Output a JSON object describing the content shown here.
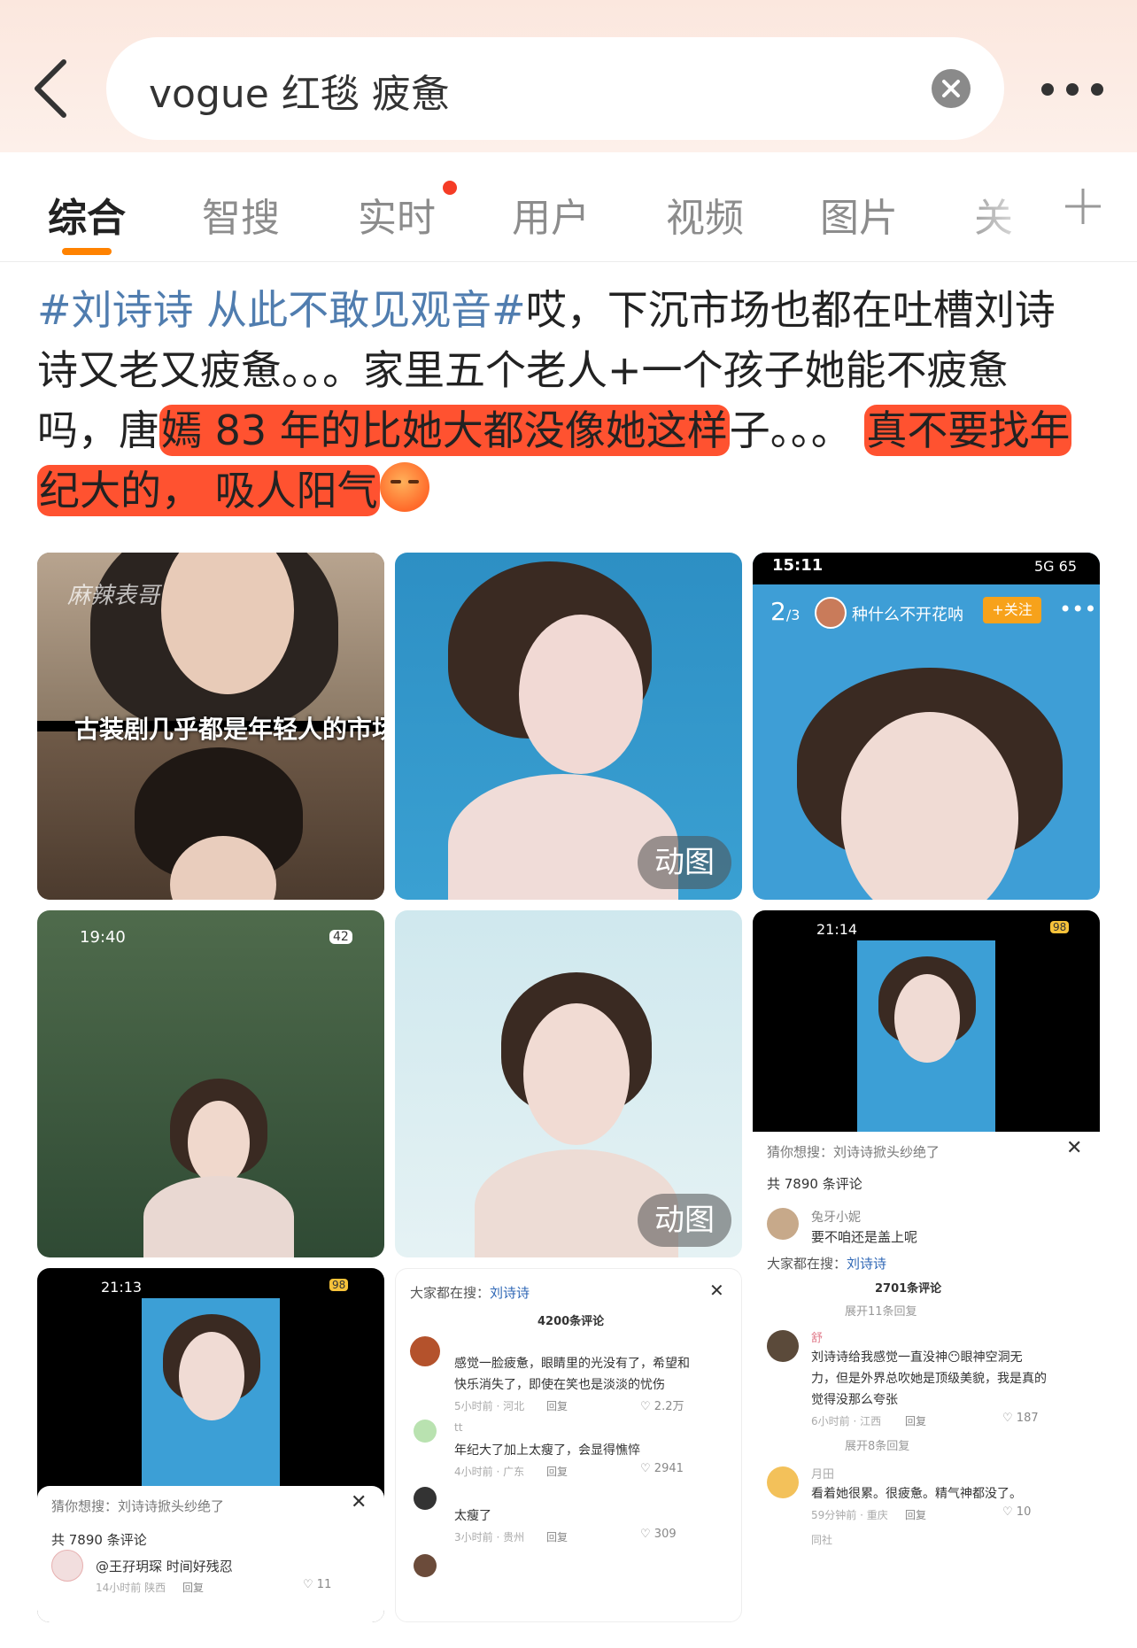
{
  "search": {
    "query": "vogue 红毯 疲惫"
  },
  "tabs": [
    {
      "label": "综合"
    },
    {
      "label": "智搜"
    },
    {
      "label": "实时"
    },
    {
      "label": "用户"
    },
    {
      "label": "视频"
    },
    {
      "label": "图片"
    },
    {
      "label": "关"
    }
  ],
  "post": {
    "hashtag": "#刘诗诗 从此不敢见观音#",
    "line1_rest": "哎，下沉市场也都在吐槽刘诗",
    "line2": "诗又老又疲惫。。。家里五个老人+一个孩子她能不疲惫",
    "line3_a": "吗，唐",
    "line3_hl": "嫣 83 年的比她大都没像她这样",
    "line3_b": "子。。。",
    "line3_hl2": "真不要找年",
    "line4_hl": "纪大的， 吸人阳气"
  },
  "tiles": {
    "t1": {
      "watermark": "麻辣表哥",
      "caption": "古装剧几乎都是年轻人的市场"
    },
    "t2": {
      "badge": "动图"
    },
    "t3": {
      "time": "15:11",
      "status": "5G 65",
      "page": "2",
      "page_total": "/3",
      "user": "种什么不开花呐",
      "follow": "+关注"
    },
    "t4": {
      "time": "19:40",
      "battery": "42"
    },
    "t5": {
      "badge": "动图"
    },
    "t6": {
      "time": "21:14",
      "battery": "98",
      "suggest": "猜你想搜：刘诗诗掀头纱绝了",
      "count": "共 7890 条评论",
      "c_user": "兔牙小妮",
      "c_text": "要不咱还是盖上呢",
      "hot": "大家都在搜：",
      "hot_link": "刘诗诗",
      "count2": "2701条评论",
      "expand": "展开11条回复",
      "c2_user": "舒",
      "c2_text_1": "刘诗诗给我感觉一直没神",
      "c2_text_1b": "眼神空洞无",
      "c2_text_2": "力，但是外界总吹她是顶级美貌，我是真的",
      "c2_text_3": "觉得没那么夸张",
      "c2_meta": "6小时前 · 江西",
      "c2_reply": "回复",
      "c2_likes": "187",
      "expand2": "展开8条回复",
      "c3_user": "月田",
      "c3_text": "看着她很累。很疲惫。精气神都没了。",
      "c3_meta": "59分钟前 · 重庆",
      "c3_reply": "回复",
      "c3_likes": "10",
      "c4_user": "同社"
    },
    "t7": {
      "time": "21:13",
      "battery": "98",
      "suggest": "猜你想搜：刘诗诗掀头纱绝了",
      "count": "共 7890 条评论",
      "c_text": "@王孖玥琛 时间好残忍",
      "c_meta": "14小时前 陕西",
      "c_reply": "回复",
      "c_likes": "11"
    },
    "t8": {
      "hot": "大家都在搜：",
      "hot_link": "刘诗诗",
      "count": "4200条评论",
      "c1_text_1": "感觉一脸疲惫，眼睛里的光没有了，希望和",
      "c1_text_2": "快乐消失了，即使在笑也是淡淡的忧伤",
      "c1_meta": "5小时前 · 河北",
      "c1_reply": "回复",
      "c1_likes": "2.2万",
      "c2_user": "tt",
      "c2_text": "年纪大了加上太瘦了，会显得憔悴",
      "c2_meta": "4小时前 · 广东",
      "c2_reply": "回复",
      "c2_likes": "2941",
      "c3_text": "太瘦了",
      "c3_meta": "3小时前 · 贵州",
      "c3_reply": "回复",
      "c3_likes": "309"
    }
  },
  "colors": {
    "accent": "#ff8200",
    "hashtag": "#507daf",
    "highlight": "#ff5230",
    "tab_dot": "#f53c26"
  }
}
